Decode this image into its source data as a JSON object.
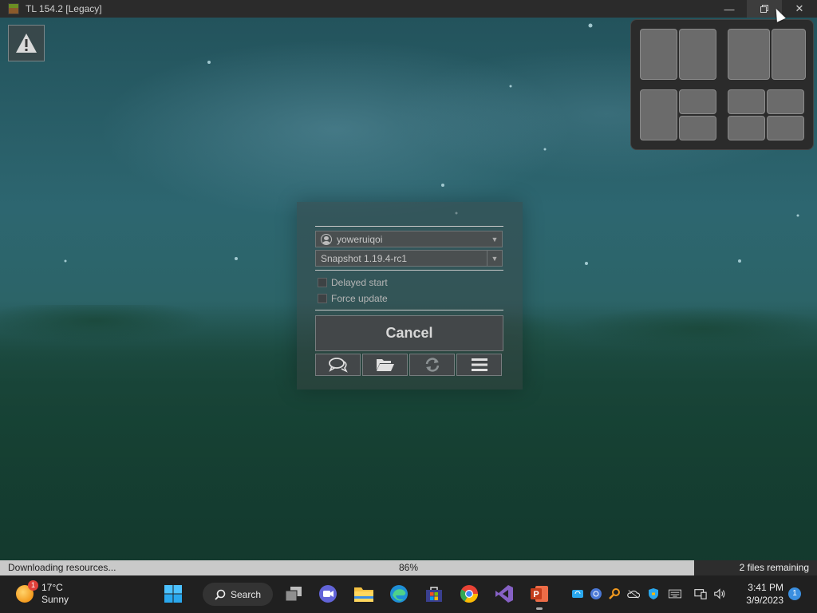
{
  "window": {
    "title": "TL 154.2 [Legacy]",
    "controls": [
      "minimize",
      "restore",
      "close"
    ]
  },
  "launcher": {
    "account": "yoweruiqoi",
    "version": "Snapshot 1.19.4-rc1",
    "options": [
      {
        "label": "Delayed start",
        "checked": false
      },
      {
        "label": "Force update",
        "checked": false
      }
    ],
    "cancel_label": "Cancel",
    "toolbar_icons": [
      "chat-icon",
      "folder-icon",
      "refresh-icon",
      "menu-icon"
    ]
  },
  "status": {
    "message": "Downloading resources...",
    "percent_label": "86%",
    "progress": 0.85,
    "remaining": "2 files remaining"
  },
  "snap_layouts": [
    "half-half",
    "two-thirds-one-third",
    "one-big-two-stacked",
    "four-quadrants"
  ],
  "taskbar": {
    "weather": {
      "temp": "17°C",
      "condition": "Sunny",
      "badge": "1"
    },
    "search_label": "Search",
    "pinned": [
      "start",
      "task-view",
      "meet",
      "file-explorer",
      "edge",
      "store",
      "chrome",
      "visual-studio",
      "powerpoint"
    ],
    "clock": {
      "time": "3:41 PM",
      "date": "3/9/2023"
    },
    "notification_count": "1"
  },
  "colors": {
    "scene_top": "#23535c",
    "scene_bottom": "#173f36",
    "progress_fill": "#c9c9c9",
    "taskbar": "#202020"
  }
}
